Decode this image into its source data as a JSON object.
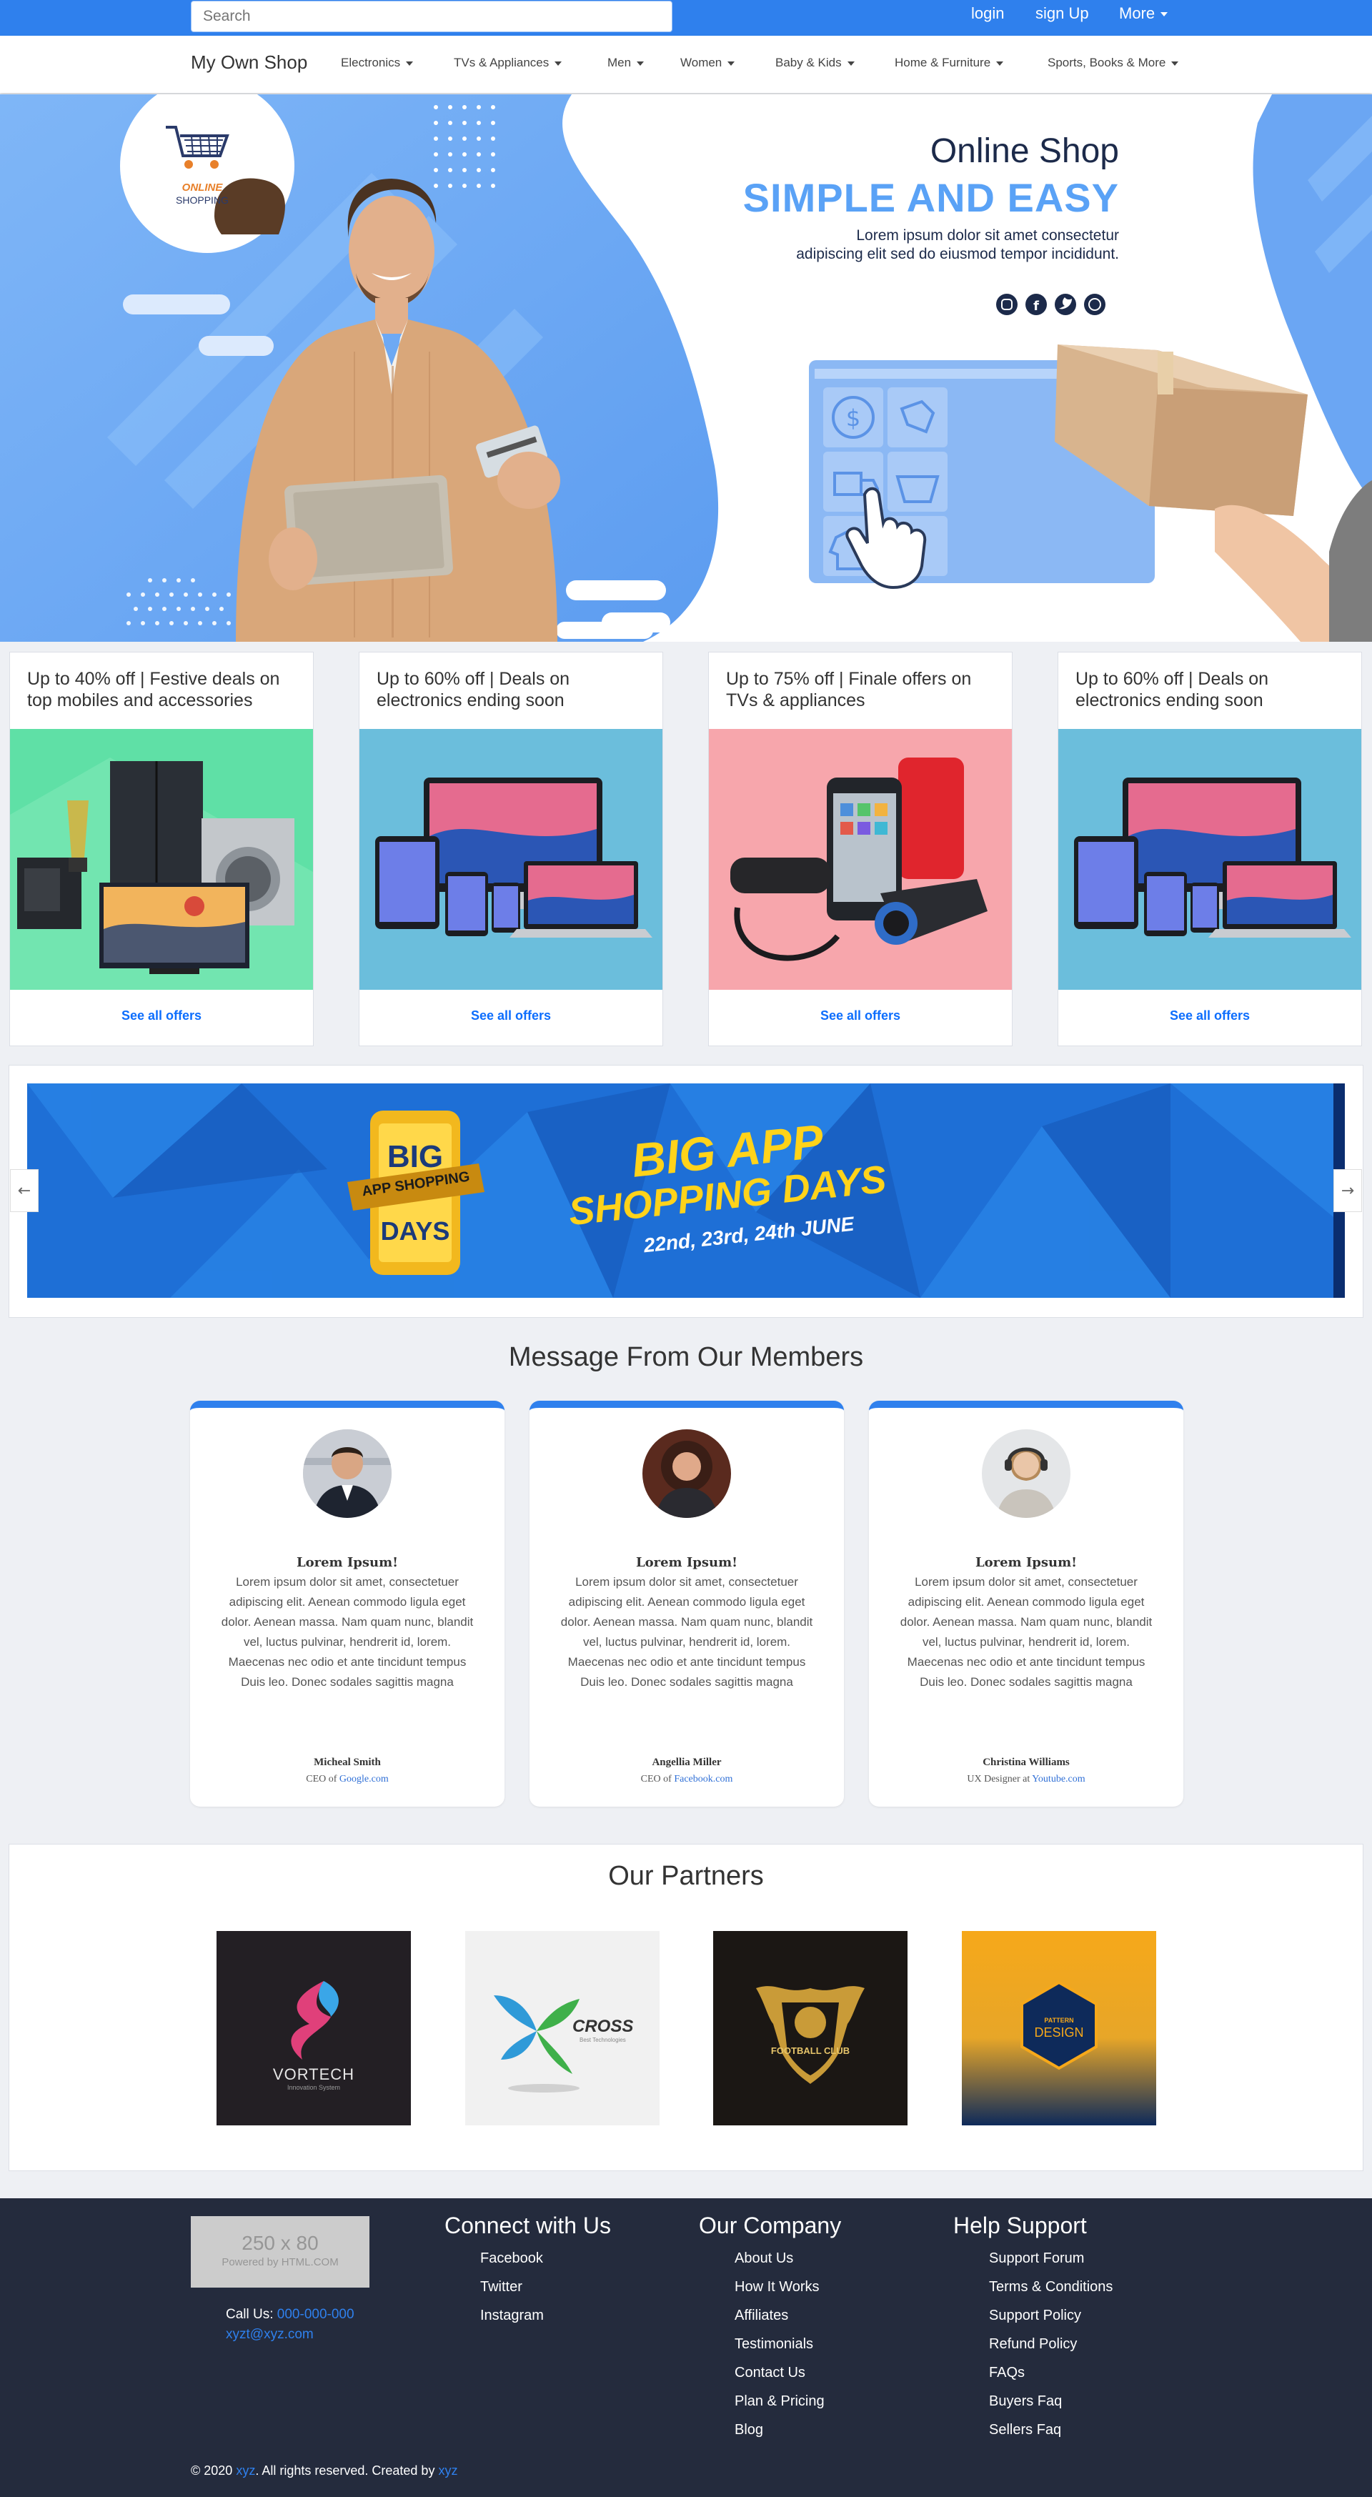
{
  "search": {
    "placeholder": "Search"
  },
  "topbar": {
    "login": "login",
    "signup": "sign Up",
    "more": "More"
  },
  "nav": {
    "brand": "My Own Shop",
    "items": [
      "Electronics",
      "TVs & Appliances",
      "Men",
      "Women",
      "Baby & Kids",
      "Home & Furniture",
      "Sports, Books & More"
    ]
  },
  "hero": {
    "logo_line1": "ONLINE",
    "logo_line2": "SHOPPING",
    "title": "Online Shop",
    "subtitle": "SIMPLE AND EASY",
    "text_line1": "Lorem ipsum dolor sit amet consectetur",
    "text_line2": "adipiscing elit sed do eiusmod tempor incididunt.",
    "social_icons": [
      "instagram-icon",
      "facebook-icon",
      "twitter-icon",
      "whatsapp-icon"
    ]
  },
  "deals": [
    {
      "title": "Up to 40% off | Festive deals on top mobiles and accessories",
      "link": "See all offers",
      "bg": "#5fe0a6"
    },
    {
      "title": "Up to 60% off | Deals on electronics ending soon",
      "link": "See all offers",
      "bg": "#6bbedc"
    },
    {
      "title": "Up to 75% off | Finale offers on TVs & appliances",
      "link": "See all offers",
      "bg": "#f7a6ac"
    },
    {
      "title": "Up to 60% off | Deals on electronics ending soon",
      "link": "See all offers",
      "bg": "#6bbedc"
    }
  ],
  "banner": {
    "phone_line1": "BIG",
    "phone_ribbon": "APP SHOPPING",
    "phone_line2": "DAYS",
    "headline1": "BIG APP",
    "headline2": "SHOPPING DAYS",
    "dates": "22nd, 23rd, 24th JUNE"
  },
  "members": {
    "title": "Message From Our Members",
    "cards": [
      {
        "heading": "Lorem Ipsum!",
        "body": "Lorem ipsum dolor sit amet, consectetuer adipiscing elit. Aenean commodo ligula eget dolor. Aenean massa. Nam quam nunc, blandit vel, luctus pulvinar, hendrerit id, lorem. Maecenas nec odio et ante tincidunt tempus Duis leo. Donec sodales sagittis magna",
        "name": "Micheal Smith",
        "role_prefix": "CEO of",
        "company": "Google.com"
      },
      {
        "heading": "Lorem Ipsum!",
        "body": "Lorem ipsum dolor sit amet, consectetuer adipiscing elit. Aenean commodo ligula eget dolor. Aenean massa. Nam quam nunc, blandit vel, luctus pulvinar, hendrerit id, lorem. Maecenas nec odio et ante tincidunt tempus Duis leo. Donec sodales sagittis magna",
        "name": "Angellia Miller",
        "role_prefix": "CEO of",
        "company": "Facebook.com"
      },
      {
        "heading": "Lorem Ipsum!",
        "body": "Lorem ipsum dolor sit amet, consectetuer adipiscing elit. Aenean commodo ligula eget dolor. Aenean massa. Nam quam nunc, blandit vel, luctus pulvinar, hendrerit id, lorem. Maecenas nec odio et ante tincidunt tempus Duis leo. Donec sodales sagittis magna",
        "name": "Christina Williams",
        "role_prefix": "UX Designer at",
        "company": "Youtube.com"
      }
    ]
  },
  "partners": {
    "title": "Our Partners",
    "logos": [
      {
        "name": "VORTECH",
        "tag": "Innovation System"
      },
      {
        "name": "CROSS",
        "tag": "Best Technologies"
      },
      {
        "name": "FOOTBALL CLUB",
        "tag": ""
      },
      {
        "name": "DESIGN",
        "tag": "PATTERN"
      }
    ]
  },
  "footer": {
    "placeholder_size": "250 x 80",
    "placeholder_caption": "Powered by HTML.COM",
    "call_label": "Call Us:",
    "phone": "000-000-000",
    "email": "xyzt@xyz.com",
    "columns": [
      {
        "heading": "Connect with Us",
        "items": [
          "Facebook",
          "Twitter",
          "Instagram"
        ]
      },
      {
        "heading": "Our Company",
        "items": [
          "About Us",
          "How It Works",
          "Affiliates",
          "Testimonials",
          "Contact Us",
          "Plan & Pricing",
          "Blog"
        ]
      },
      {
        "heading": "Help Support",
        "items": [
          "Support Forum",
          "Terms & Conditions",
          "Support Policy",
          "Refund Policy",
          "FAQs",
          "Buyers Faq",
          "Sellers Faq"
        ]
      }
    ],
    "copyright_prefix": "© 2020",
    "copyright_link1": "xyz",
    "copyright_mid": ". All rights reserved. Created by",
    "copyright_link2": "xyz"
  }
}
